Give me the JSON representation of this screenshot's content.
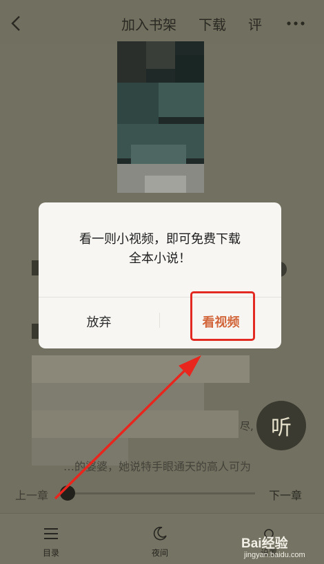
{
  "topbar": {
    "add_to_shelf": "加入书架",
    "download": "下载",
    "review": "评"
  },
  "body": {
    "listen_label": "听",
    "blur_text_1": "尽,",
    "blur_text_2": "…的婆婆，她说特手眼通天的高人可为"
  },
  "chapter": {
    "prev": "上一章",
    "next": "下一章"
  },
  "bottombar": {
    "toc": "目录",
    "night": "夜间",
    "settings": "设置"
  },
  "dialog": {
    "message_line1": "看一则小视频，即可免费下载",
    "message_line2": "全本小说！",
    "cancel": "放弃",
    "watch": "看视频"
  },
  "watermark": {
    "brand": "Bai经验",
    "url": "jingyan.baidu.com"
  },
  "colors": {
    "accent": "#d2663a",
    "highlight": "#e22a22",
    "overlay": "#727060"
  }
}
